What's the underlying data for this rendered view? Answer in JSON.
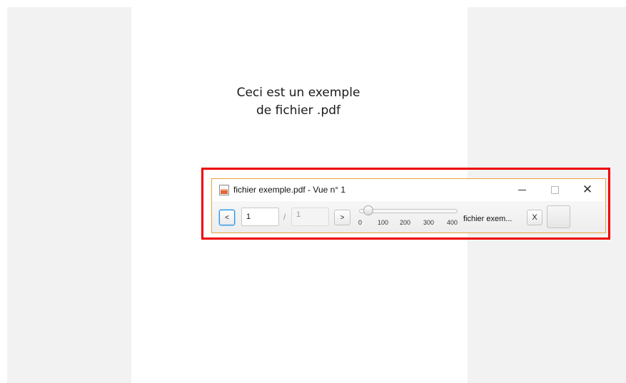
{
  "pdf_page": {
    "line1": "Ceci est un exemple",
    "line2": "de fichier .pdf"
  },
  "window": {
    "title": "fichier exemple.pdf - Vue n° 1",
    "minimize_glyph": "—",
    "maximize_glyph": "☐",
    "close_glyph": "✕"
  },
  "toolbar": {
    "prev_label": "<",
    "next_label": ">",
    "page_value": "1",
    "page_separator": "/",
    "page_total": "1",
    "zoom": {
      "ticks": [
        "0",
        "100",
        "200",
        "300",
        "400"
      ],
      "value": 0
    },
    "doc_name": "fichier exem...",
    "close_doc_label": "X"
  },
  "colors": {
    "highlight": "#ee0000",
    "window_border": "#e8a43c",
    "focus": "#2f93e0"
  }
}
